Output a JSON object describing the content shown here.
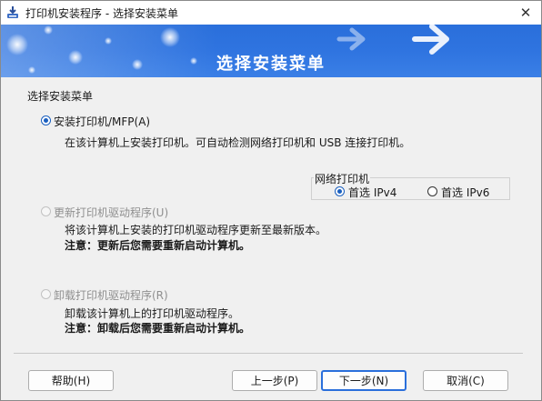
{
  "window": {
    "title": "打印机安装程序 - 选择安装菜单",
    "close_glyph": "✕"
  },
  "banner": {
    "title": "选择安装菜单"
  },
  "section_label": "选择安装菜单",
  "options": [
    {
      "label": "安装打印机/MFP(A)",
      "description": "在该计算机上安装打印机。可自动检测网络打印机和 USB 连接打印机。",
      "checked": true,
      "enabled": true
    },
    {
      "label": "更新打印机驱动程序(U)",
      "description": "将该计算机上安装的打印机驱动程序更新至最新版本。",
      "note": "注意：更新后您需要重新启动计算机。",
      "checked": false,
      "enabled": false
    },
    {
      "label": "卸载打印机驱动程序(R)",
      "description": "卸载该计算机上的打印机驱动程序。",
      "note": "注意：卸载后您需要重新启动计算机。",
      "checked": false,
      "enabled": false
    }
  ],
  "network": {
    "legend": "网络打印机",
    "ipv4_label": "首选 IPv4",
    "ipv6_label": "首选 IPv6",
    "selected": "IPv4"
  },
  "buttons": {
    "help": "帮助(H)",
    "back": "上一步(P)",
    "next": "下一步(N)",
    "cancel": "取消(C)"
  },
  "colors": {
    "banner_blue": "#2f74e0",
    "accent": "#1a5fbf",
    "default_button_border": "#2a6fdb"
  }
}
